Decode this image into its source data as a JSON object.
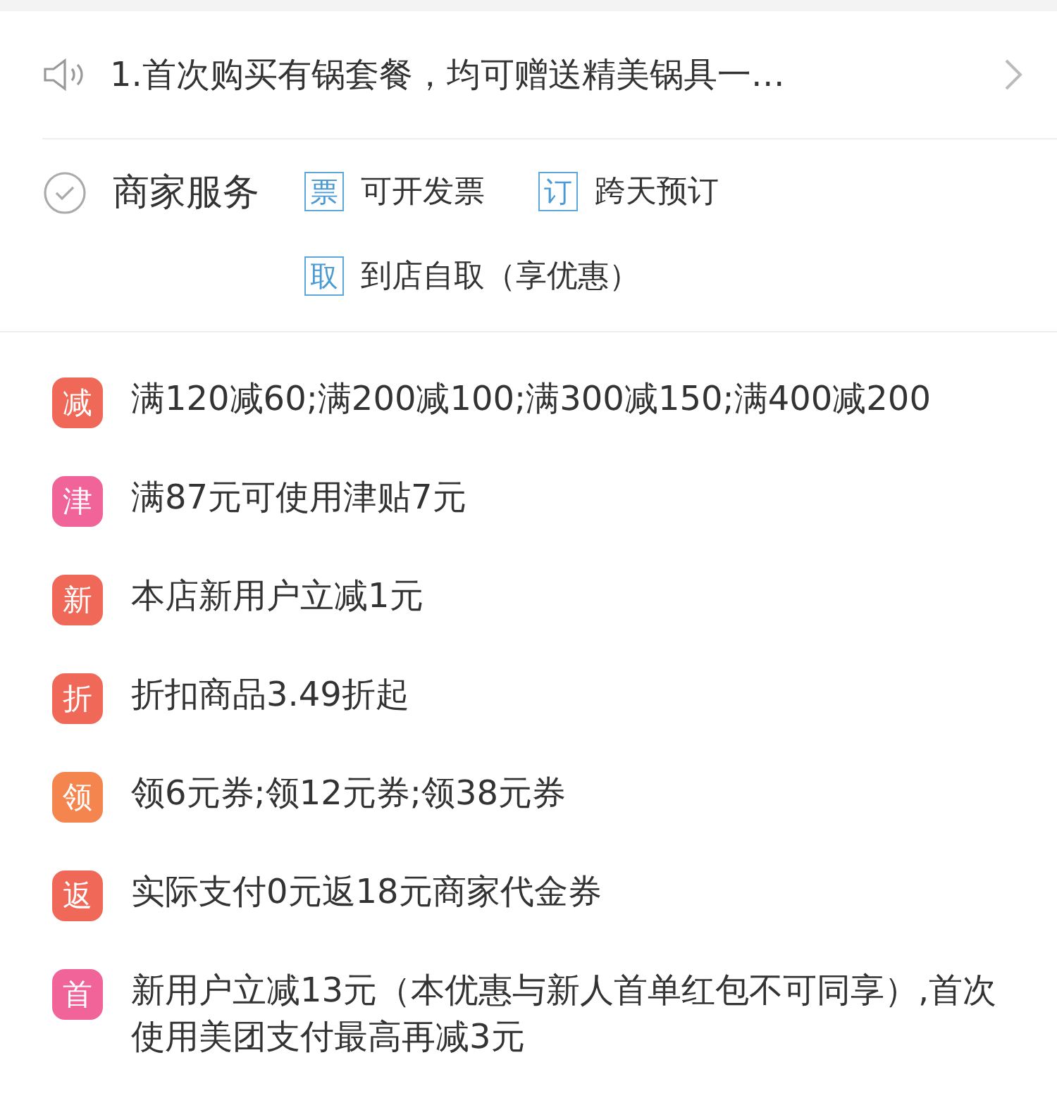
{
  "notice": {
    "text": "1.首次购买有锅套餐，均可赠送精美锅具一…"
  },
  "services": {
    "title": "商家服务",
    "items": [
      {
        "badge": "票",
        "label": "可开发票"
      },
      {
        "badge": "订",
        "label": "跨天预订"
      },
      {
        "badge": "取",
        "label": "到店自取（享优惠）"
      }
    ]
  },
  "offers": [
    {
      "badge": "减",
      "color": "#f06858",
      "text": "满120减60;满200减100;满300减150;满400减200"
    },
    {
      "badge": "津",
      "color": "#f0649a",
      "text": "满87元可使用津贴7元"
    },
    {
      "badge": "新",
      "color": "#f06858",
      "text": "本店新用户立减1元"
    },
    {
      "badge": "折",
      "color": "#f06858",
      "text": "折扣商品3.49折起"
    },
    {
      "badge": "领",
      "color": "#f5854f",
      "text": "领6元券;领12元券;领38元券"
    },
    {
      "badge": "返",
      "color": "#f06858",
      "text": "实际支付0元返18元商家代金券"
    },
    {
      "badge": "首",
      "color": "#f0649a",
      "text": "新用户立减13元（本优惠与新人首单红包不可同享）,首次使用美团支付最高再减3元"
    }
  ]
}
